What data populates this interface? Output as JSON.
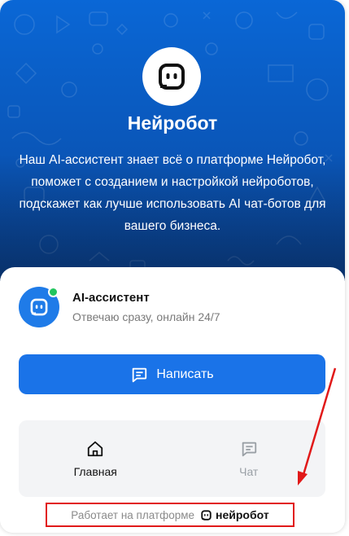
{
  "hero": {
    "title": "Нейробот",
    "description": "Наш AI-ассистент знает всё о платформе Нейробот, поможет с созданием и настройкой нейроботов, подскажет как лучше использовать AI чат-ботов для вашего бизнеса.",
    "logo_icon": "robot-face-icon"
  },
  "agent": {
    "name": "AI-ассистент",
    "status": "Отвечаю сразу, онлайн 24/7",
    "online": true,
    "online_color": "#22c55e"
  },
  "write_button": {
    "label": "Написать",
    "icon": "chat-bubble-icon"
  },
  "nav": {
    "tabs": [
      {
        "label": "Главная",
        "icon": "home-icon",
        "active": true
      },
      {
        "label": "Чат",
        "icon": "chat-bubble-icon",
        "active": false
      }
    ]
  },
  "footer": {
    "text": "Работает на платформе",
    "brand": "нейробот"
  },
  "colors": {
    "accent": "#1a73e8",
    "hero_top": "#0a67d6",
    "hero_bottom": "#0b3f86",
    "annotation": "#e11919"
  }
}
